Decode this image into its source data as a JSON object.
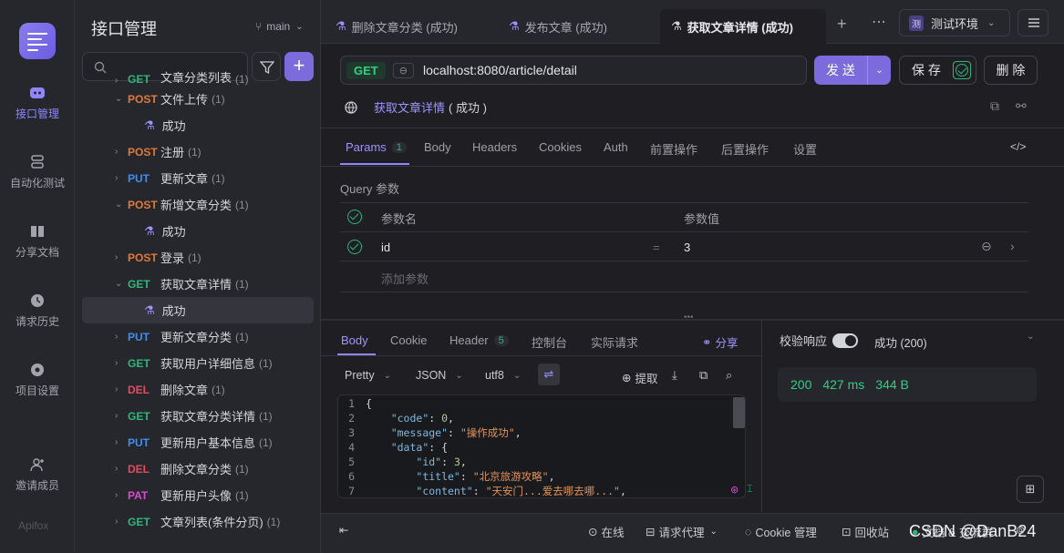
{
  "rail": {
    "items": [
      {
        "label": "接口管理",
        "icon": "api-icon"
      },
      {
        "label": "自动化测试",
        "icon": "automation-icon"
      },
      {
        "label": "分享文档",
        "icon": "book-icon"
      },
      {
        "label": "请求历史",
        "icon": "clock-icon"
      },
      {
        "label": "项目设置",
        "icon": "gear-icon"
      },
      {
        "label": "邀请成员",
        "icon": "user-add-icon"
      }
    ],
    "brand": "Apifox"
  },
  "tree": {
    "title": "接口管理",
    "branch": "main",
    "rows": [
      {
        "method": "GET",
        "name": "文章分类列表",
        "count": "(1)",
        "expanded": false
      },
      {
        "method": "POST",
        "name": "文件上传",
        "count": "(1)",
        "expanded": true
      },
      {
        "method": "",
        "name": "成功",
        "count": "",
        "child": true
      },
      {
        "method": "POST",
        "name": "注册",
        "count": "(1)",
        "expanded": false
      },
      {
        "method": "PUT",
        "name": "更新文章",
        "count": "(1)",
        "expanded": false
      },
      {
        "method": "POST",
        "name": "新增文章分类",
        "count": "(1)",
        "expanded": true
      },
      {
        "method": "",
        "name": "成功",
        "count": "",
        "child": true
      },
      {
        "method": "POST",
        "name": "登录",
        "count": "(1)",
        "expanded": false
      },
      {
        "method": "GET",
        "name": "获取文章详情",
        "count": "(1)",
        "expanded": true
      },
      {
        "method": "",
        "name": "成功",
        "count": "",
        "child": true,
        "selected": true
      },
      {
        "method": "PUT",
        "name": "更新文章分类",
        "count": "(1)",
        "expanded": false
      },
      {
        "method": "GET",
        "name": "获取用户详细信息",
        "count": "(1)",
        "expanded": false
      },
      {
        "method": "DEL",
        "name": "删除文章",
        "count": "(1)",
        "expanded": false
      },
      {
        "method": "GET",
        "name": "获取文章分类详情",
        "count": "(1)",
        "expanded": false
      },
      {
        "method": "PUT",
        "name": "更新用户基本信息",
        "count": "(1)",
        "expanded": false
      },
      {
        "method": "DEL",
        "name": "删除文章分类",
        "count": "(1)",
        "expanded": false
      },
      {
        "method": "PAT",
        "name": "更新用户头像",
        "count": "(1)",
        "expanded": false
      },
      {
        "method": "GET",
        "name": "文章列表(条件分页)",
        "count": "(1)",
        "expanded": false
      }
    ]
  },
  "tabs": [
    {
      "label": "删除文章分类 (成功)",
      "active": false
    },
    {
      "label": "发布文章 (成功)",
      "active": false
    },
    {
      "label": "获取文章详情 (成功)",
      "active": true
    }
  ],
  "env": {
    "badge": "测",
    "label": "测试环境"
  },
  "request": {
    "method": "GET",
    "url": "localhost:8080/article/detail",
    "send": "发 送",
    "save": "保 存",
    "delete": "删 除",
    "name": "获取文章详情",
    "name_suffix": "( 成功 )"
  },
  "param_tabs": [
    {
      "label": "Params",
      "badge": "1"
    },
    {
      "label": "Body"
    },
    {
      "label": "Headers"
    },
    {
      "label": "Cookies"
    },
    {
      "label": "Auth"
    },
    {
      "label": "前置操作"
    },
    {
      "label": "后置操作"
    },
    {
      "label": "设置"
    }
  ],
  "query": {
    "title": "Query 参数",
    "col_name": "参数名",
    "col_value": "参数值",
    "rows": [
      {
        "name": "id",
        "eq": "=",
        "value": "3"
      }
    ],
    "add_placeholder": "添加参数"
  },
  "response": {
    "tabs": [
      {
        "label": "Body"
      },
      {
        "label": "Cookie"
      },
      {
        "label": "Header",
        "badge": "5"
      },
      {
        "label": "控制台"
      },
      {
        "label": "实际请求"
      }
    ],
    "share": "分享",
    "format": "Pretty",
    "lang": "JSON",
    "encoding": "utf8",
    "extract": "提取",
    "validate_label": "校验响应",
    "status_label": "成功 (200)",
    "status": "200",
    "time": "427 ms",
    "size": "344 B",
    "code_lines": [
      {
        "n": "1",
        "text": "{"
      },
      {
        "n": "2",
        "key": "\"code\"",
        "val": "0",
        "type": "num"
      },
      {
        "n": "3",
        "key": "\"message\"",
        "val": "\"操作成功\"",
        "type": "str"
      },
      {
        "n": "4",
        "key": "\"data\"",
        "val": "{",
        "type": "punct"
      },
      {
        "n": "5",
        "key": "\"id\"",
        "val": "3",
        "type": "num",
        "indent": 2
      },
      {
        "n": "6",
        "key": "\"title\"",
        "val": "\"北京旅游攻略\"",
        "type": "str",
        "indent": 2
      },
      {
        "n": "7",
        "key": "\"content\"",
        "val": "\"天安门...爱去哪去哪...\"",
        "type": "str",
        "indent": 2
      }
    ]
  },
  "footer": {
    "online": "在线",
    "proxy": "请求代理",
    "cookie": "Cookie 管理",
    "recycle": "回收站",
    "docs": "文档 & 交流群",
    "watermark": "CSDN @DanB24"
  }
}
